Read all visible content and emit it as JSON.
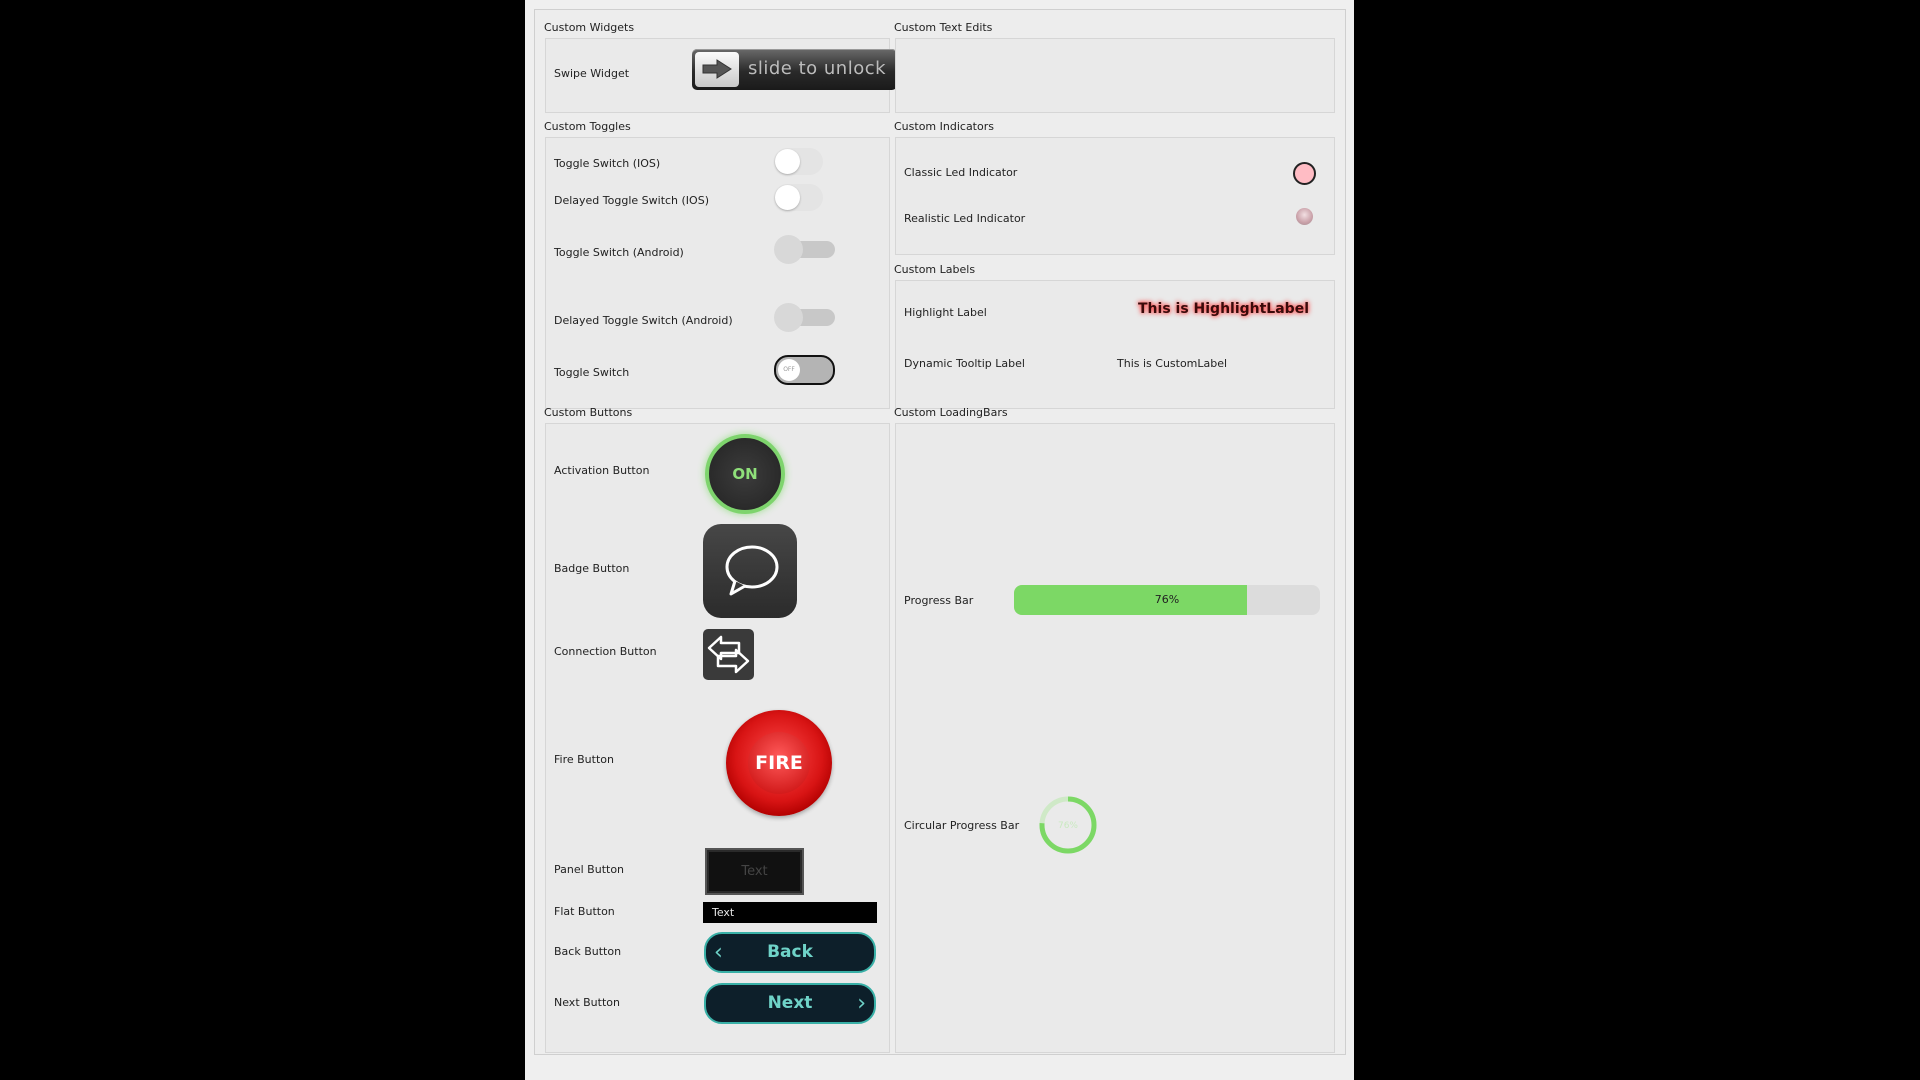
{
  "groups": {
    "custom_widgets": "Custom Widgets",
    "custom_text_edits": "Custom Text Edits",
    "custom_toggles": "Custom Toggles",
    "custom_indicators": "Custom Indicators",
    "custom_labels": "Custom Labels",
    "custom_buttons": "Custom Buttons",
    "custom_loadingbars": "Custom LoadingBars"
  },
  "widgets": {
    "swipe_label": "Swipe Widget",
    "swipe_text": "slide to unlock"
  },
  "toggles": {
    "ios": "Toggle Switch (IOS)",
    "delayed_ios": "Delayed Toggle Switch (IOS)",
    "android": "Toggle Switch (Android)",
    "delayed_android": "Delayed Toggle Switch (Android)",
    "toggle": "Toggle Switch",
    "toggle_knob_text": "OFF"
  },
  "indicators": {
    "classic": "Classic Led Indicator",
    "realistic": "Realistic Led Indicator",
    "classic_color": "#ffbcc4"
  },
  "labels": {
    "highlight_label": "Highlight Label",
    "highlight_text": "This is HighlightLabel",
    "tooltip_label": "Dynamic Tooltip Label",
    "tooltip_text": "This is CustomLabel"
  },
  "buttons": {
    "activation_label": "Activation Button",
    "activation_text": "ON",
    "badge_label": "Badge Button",
    "connection_label": "Connection Button",
    "fire_label": "Fire Button",
    "fire_text": "FIRE",
    "panel_label": "Panel Button",
    "panel_text": "Text",
    "flat_label": "Flat Button",
    "flat_text": "Text",
    "back_label": "Back Button",
    "back_text": "Back",
    "next_label": "Next Button",
    "next_text": "Next"
  },
  "loadingbars": {
    "progress_label": "Progress Bar",
    "progress_value": 76,
    "progress_text": "76%",
    "circular_label": "Circular Progress Bar",
    "circular_value": 76,
    "circular_text": "76%",
    "progress_color": "#7cd865"
  }
}
